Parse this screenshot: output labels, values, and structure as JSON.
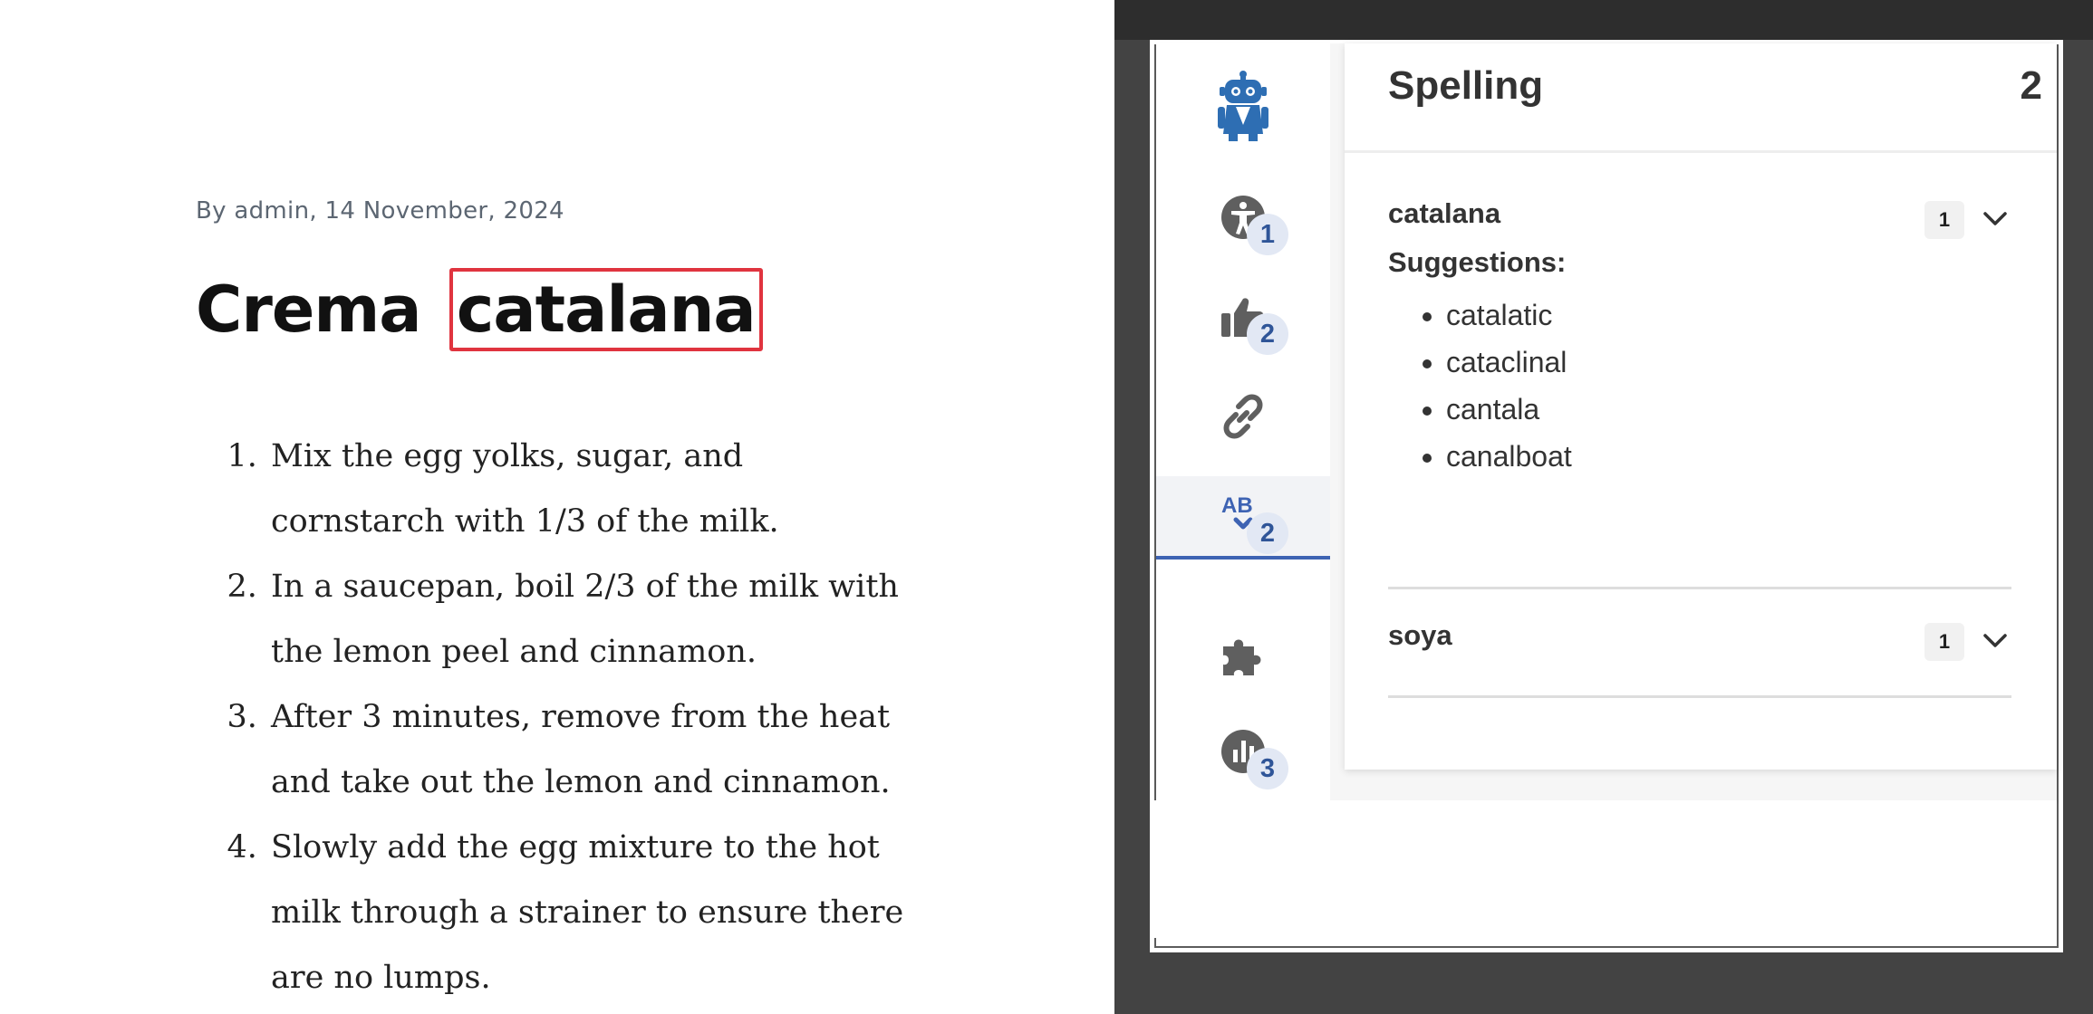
{
  "article": {
    "byline": "By admin, 14 November, 2024",
    "title_plain": "Crema",
    "title_highlight": "catalana",
    "steps": [
      "Mix the egg yolks, sugar, and cornstarch with 1/3 of the milk.",
      "In a saucepan, boil 2/3 of the milk with the lemon peel and cinnamon.",
      "After 3 minutes, remove from the heat and take out the lemon and cinnamon.",
      "Slowly add the egg mixture to the hot milk through a strainer to ensure there are no lumps."
    ],
    "highlight_color": "#e0343f"
  },
  "sidebar": {
    "items": [
      {
        "name": "robot-logo-icon",
        "badge": ""
      },
      {
        "name": "accessibility-icon",
        "badge": "1"
      },
      {
        "name": "thumbs-up-icon",
        "badge": "2"
      },
      {
        "name": "link-icon",
        "badge": ""
      },
      {
        "name": "spelling-icon",
        "badge": "2"
      },
      {
        "name": "puzzle-icon",
        "badge": ""
      },
      {
        "name": "readability-icon",
        "badge": "3"
      }
    ],
    "accent_color": "#3e63b3"
  },
  "spelling": {
    "title": "Spelling",
    "count": "2",
    "issues": [
      {
        "word": "catalana",
        "count": "1",
        "suggestions_label": "Suggestions:",
        "suggestions": [
          "catalatic",
          "cataclinal",
          "cantala",
          "canalboat"
        ]
      },
      {
        "word": "soya",
        "count": "1"
      }
    ]
  }
}
